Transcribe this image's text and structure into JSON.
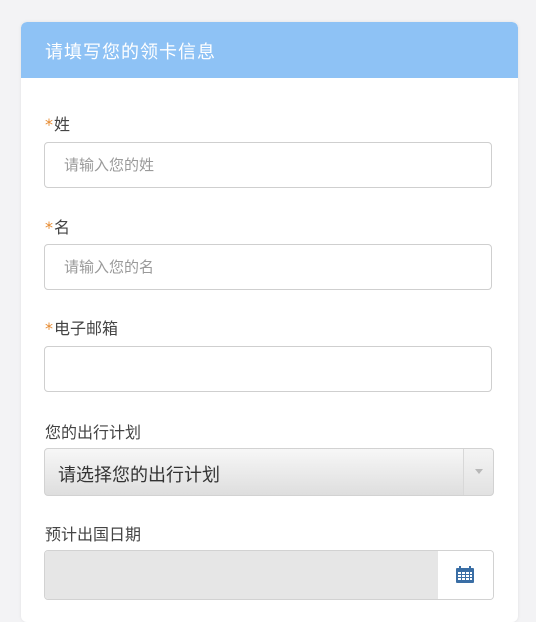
{
  "header": {
    "title": "请填写您的领卡信息"
  },
  "form": {
    "last_name": {
      "required_mark": "*",
      "label": "姓",
      "placeholder": "请输入您的姓",
      "value": ""
    },
    "first_name": {
      "required_mark": "*",
      "label": "名",
      "placeholder": "请输入您的名",
      "value": ""
    },
    "email": {
      "required_mark": "*",
      "label": "电子邮箱",
      "placeholder": "",
      "value": ""
    },
    "travel_plan": {
      "label": "您的出行计划",
      "selected": "请选择您的出行计划"
    },
    "departure_date": {
      "label": "预计出国日期",
      "value": "",
      "icon": "calendar-icon"
    }
  },
  "colors": {
    "header_bg": "#8ec2f5",
    "required_mark": "#e6892e",
    "calendar_icon": "#3a6ea5"
  }
}
